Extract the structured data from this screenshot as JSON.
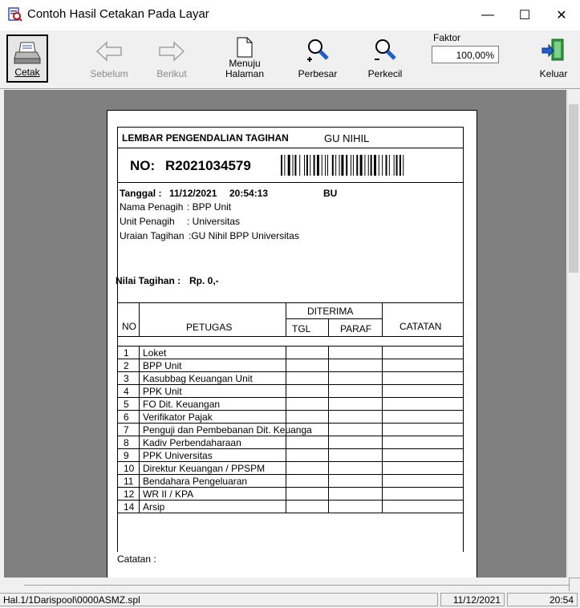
{
  "window": {
    "title": "Contoh Hasil Cetakan Pada Layar",
    "minimize": "—",
    "maximize": "☐",
    "close": "✕"
  },
  "toolbar": {
    "cetak": "Cetak",
    "sebelum": "Sebelum",
    "berikut": "Berikut",
    "menuju_line1": "Menuju",
    "menuju_line2": "Halaman",
    "perbesar": "Perbesar",
    "perkecil": "Perkecil",
    "faktor_label": "Faktor",
    "faktor_value": "100,00%",
    "keluar": "Keluar"
  },
  "doc": {
    "header_title": "LEMBAR PENGENDALIAN TAGIHAN",
    "header_type": "GU NIHIL",
    "no_label": "NO:",
    "no_value": "R2021034579",
    "tanggal_label": "Tanggal :",
    "tanggal_date": "11/12/2021",
    "tanggal_time": "20:54:13",
    "code": "BU",
    "nama_label": "Nama Penagih",
    "nama_value": ":  BPP Unit",
    "unit_label": "Unit Penagih",
    "unit_value": ":  Universitas",
    "uraian_label": "Uraian Tagihan",
    "uraian_value": ":GU Nihil BPP Universitas",
    "nilai_label": "Nilai Tagihan :",
    "nilai_value": "Rp. 0,-",
    "col_no": "NO",
    "col_petugas": "PETUGAS",
    "col_diterima": "DITERIMA",
    "col_tgl": "TGL",
    "col_paraf": "PARAF",
    "col_catatan": "CATATAN",
    "rows": [
      {
        "no": "1",
        "petugas": "Loket"
      },
      {
        "no": "2",
        "petugas": "BPP Unit"
      },
      {
        "no": "3",
        "petugas": "Kasubbag Keuangan Unit"
      },
      {
        "no": "4",
        "petugas": "PPK Unit"
      },
      {
        "no": "5",
        "petugas": "FO Dit. Keuangan"
      },
      {
        "no": "6",
        "petugas": "Verifikator Pajak"
      },
      {
        "no": "7",
        "petugas": "Penguji dan Pembebanan Dit. Keuanga"
      },
      {
        "no": "8",
        "petugas": "Kadiv Perbendaharaan"
      },
      {
        "no": "9",
        "petugas": "PPK Universitas"
      },
      {
        "no": "10",
        "petugas": "Direktur Keuangan / PPSPM"
      },
      {
        "no": "11",
        "petugas": "Bendahara Pengeluaran"
      },
      {
        "no": "12",
        "petugas": "WR II / KPA"
      },
      {
        "no": "14",
        "petugas": "Arsip"
      }
    ],
    "catatan_footer": "Catatan :"
  },
  "status": {
    "file": "Hal.1/1Darispool\\0000ASMZ.spl",
    "date": "11/12/2021",
    "time": "20:54"
  }
}
